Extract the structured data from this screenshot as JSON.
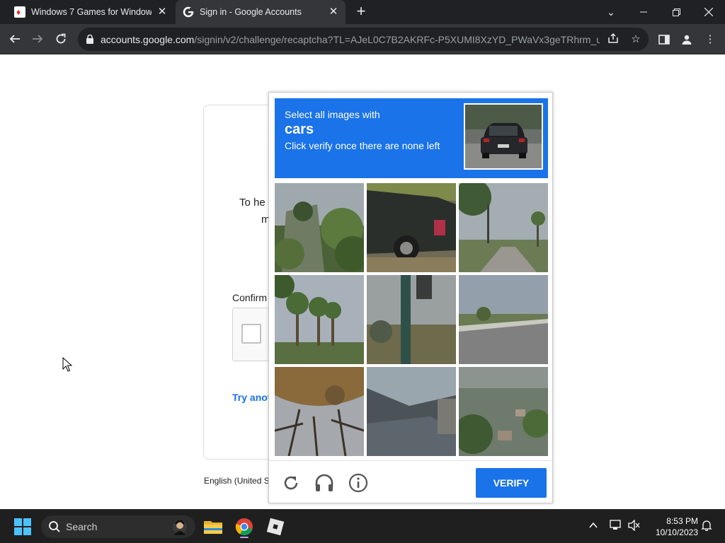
{
  "browser": {
    "tabs": [
      {
        "title": "Windows 7 Games for Windows",
        "favicon": "cards-icon"
      },
      {
        "title": "Sign in - Google Accounts",
        "favicon": "google-icon"
      }
    ],
    "url_host": "accounts.google.com",
    "url_path": "/signin/v2/challenge/recaptcha?TL=AJeL0C7B2AKRFc-P5XUMI8XzYD_PWaVx3geTRhrm_uN..."
  },
  "page": {
    "help_text_1": "To he",
    "help_text_2": "m",
    "confirm_label": "Confirm",
    "try_another": "Try anot",
    "language": "English (United S"
  },
  "challenge": {
    "line1": "Select all images with",
    "target": "cars",
    "line3": "Click verify once there are none left",
    "tiles": [
      "trees-and-fence",
      "pickup-truck-rear",
      "palm-trees-street",
      "palm-trees",
      "traffic-light-pole",
      "road-and-field",
      "tree-branches",
      "house-roof",
      "hillside-houses"
    ],
    "footer_icons": [
      "reload-icon",
      "audio-icon",
      "info-icon"
    ],
    "verify_label": "VERIFY",
    "accent_color": "#1a73e8"
  },
  "taskbar": {
    "search_label": "Search",
    "time": "8:53 PM",
    "date": "10/10/2023",
    "apps": [
      "file-explorer-icon",
      "chrome-icon",
      "roblox-icon"
    ]
  }
}
